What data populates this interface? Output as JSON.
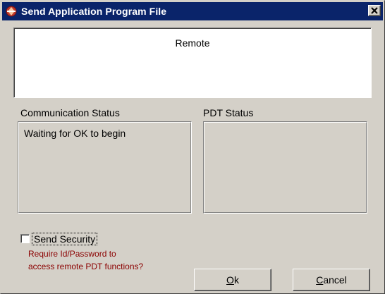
{
  "window": {
    "title": "Send Application Program File",
    "icon": "app-logo-icon",
    "close_icon": "close-icon"
  },
  "remote_panel": {
    "text": "Remote"
  },
  "communication_status": {
    "label": "Communication Status",
    "text": "Waiting for OK to begin"
  },
  "pdt_status": {
    "label": "PDT Status",
    "text": ""
  },
  "send_security": {
    "label": "Send Security",
    "checked": false,
    "hint_line1": "Require Id/Password to",
    "hint_line2": "access remote PDT functions?"
  },
  "buttons": {
    "ok": {
      "mnemonic": "O",
      "rest": "k"
    },
    "cancel": {
      "mnemonic": "C",
      "rest": "ancel"
    }
  },
  "colors": {
    "titlebar": "#0a246a",
    "hint_text": "#8b0000",
    "face": "#d4d0c8"
  }
}
